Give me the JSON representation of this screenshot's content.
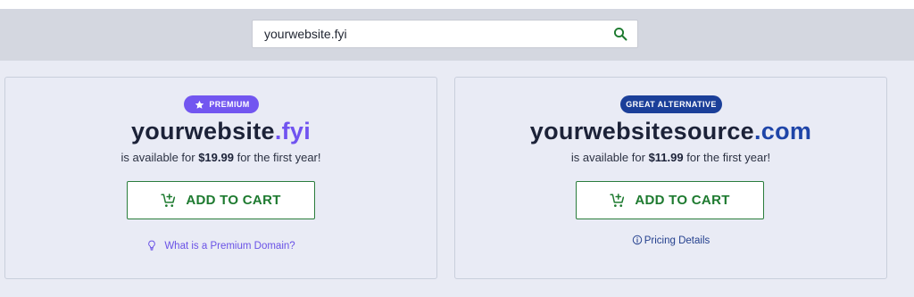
{
  "search": {
    "value": "yourwebsite.fyi",
    "icon": "search-icon"
  },
  "colors": {
    "premium_accent": "#7256f0",
    "alternative_accent": "#1b3f99",
    "cart_green": "#1d7a2f",
    "page_background": "#e9ebf4"
  },
  "results": [
    {
      "badge": "PREMIUM",
      "badge_icon": "star-icon",
      "domain_name": "yourwebsite",
      "domain_tld": ".fyi",
      "availability_prefix": "is available for ",
      "price": "$19.99",
      "availability_suffix": " for the first year!",
      "cart_label": "ADD TO CART",
      "cart_icon": "cart-plus-icon",
      "help_link": "What is a Premium Domain?",
      "help_icon": "lightbulb-icon"
    },
    {
      "badge": "GREAT ALTERNATIVE",
      "domain_name": "yourwebsitesource",
      "domain_tld": ".com",
      "availability_prefix": "is available for ",
      "price": "$11.99",
      "availability_suffix": " for the first year!",
      "cart_label": "ADD TO CART",
      "cart_icon": "cart-plus-icon",
      "help_link": "Pricing Details",
      "help_icon": "info-circle-icon"
    }
  ]
}
